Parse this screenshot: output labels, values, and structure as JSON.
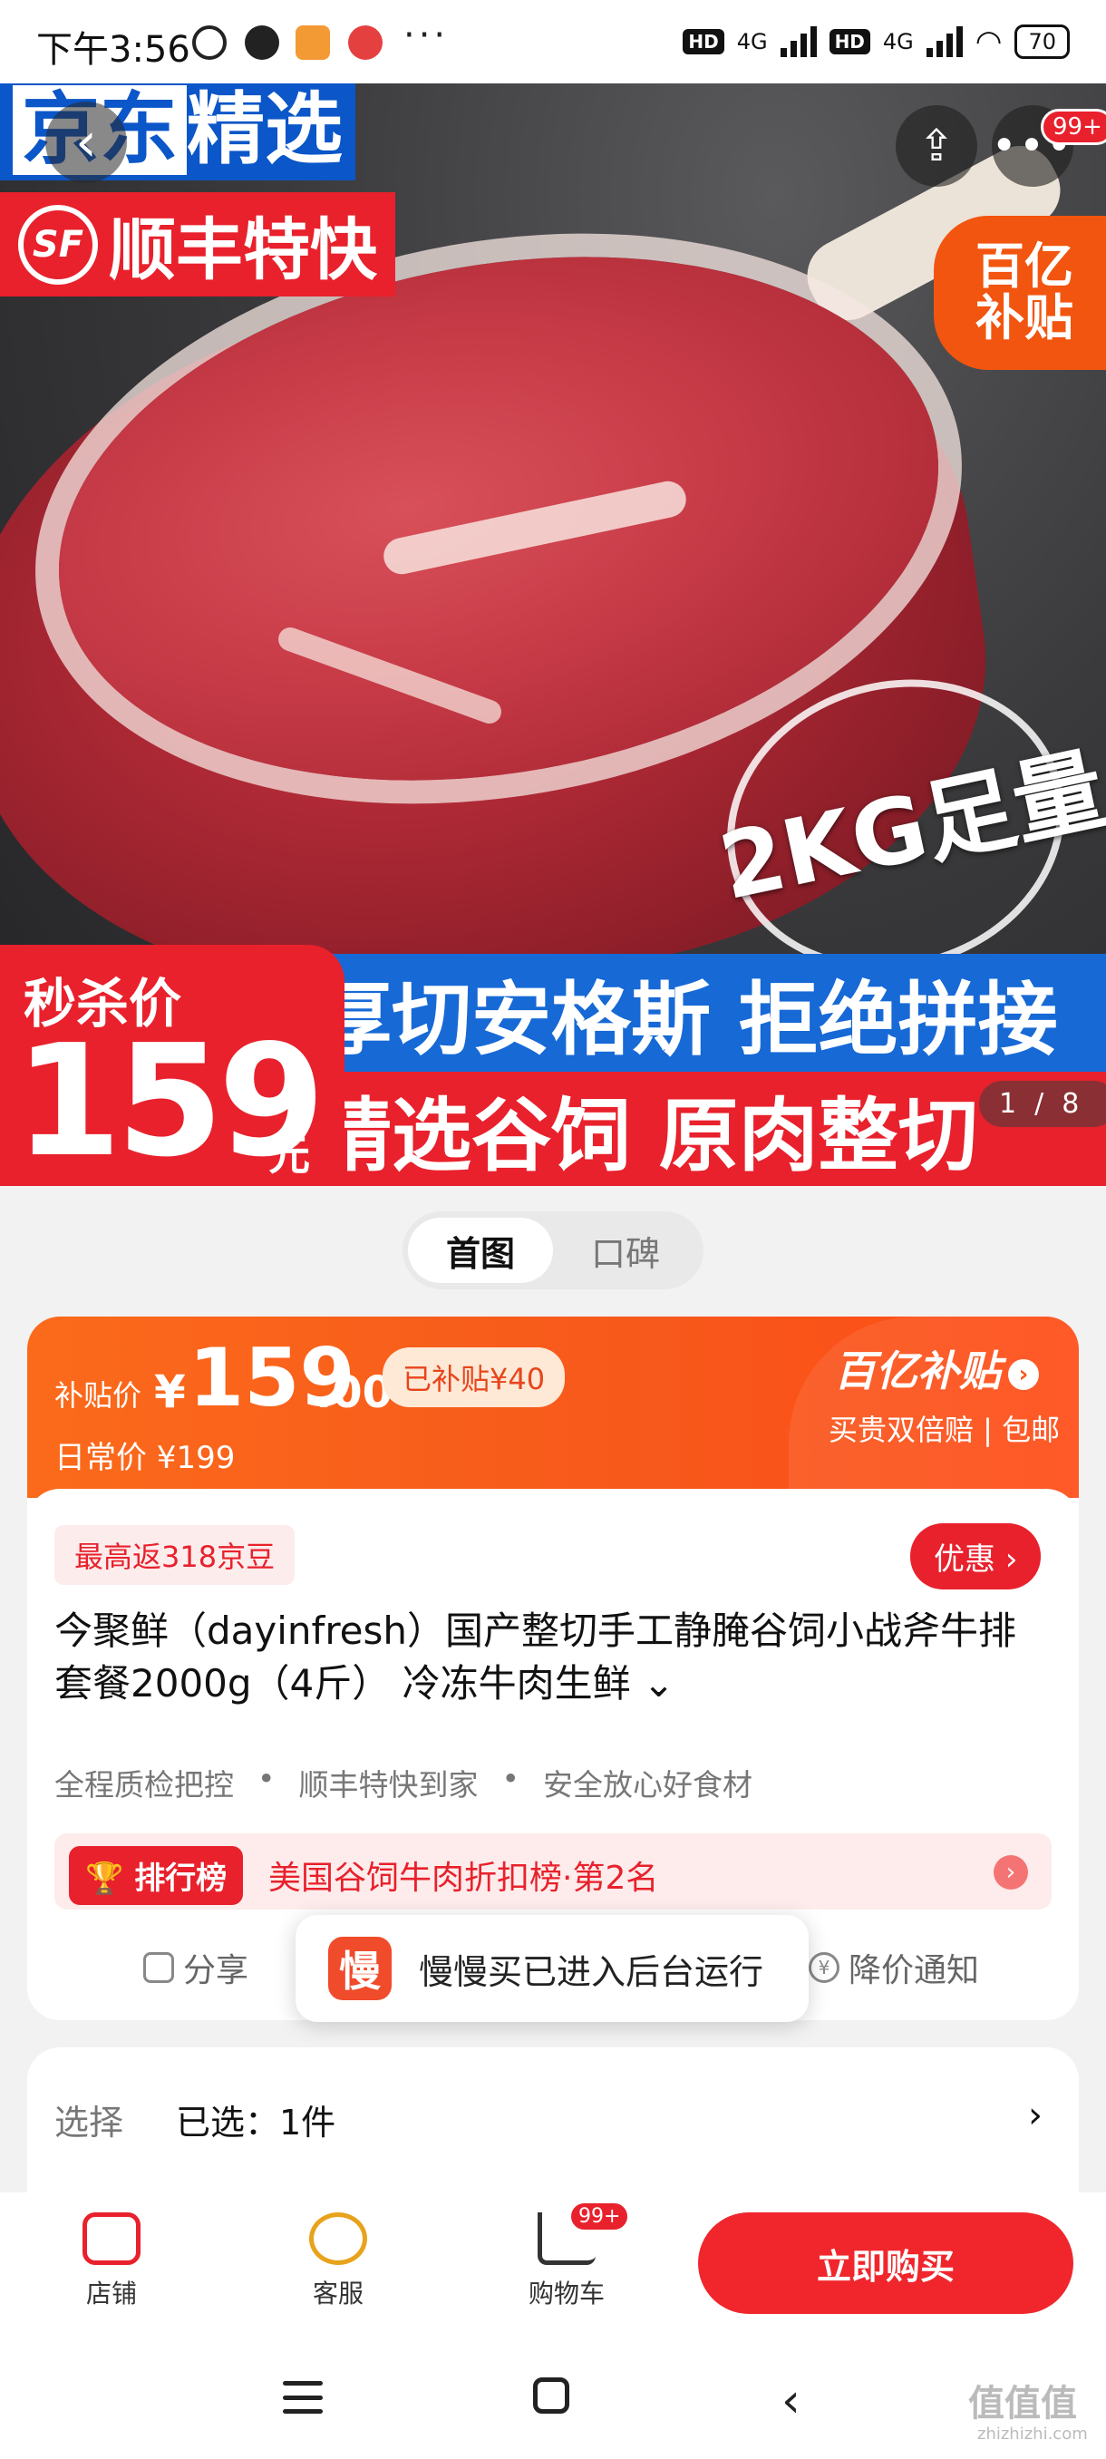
{
  "status_bar": {
    "time": "下午3:56",
    "more": "···",
    "hd1": "HD",
    "net1": "4G",
    "hd2": "HD",
    "net2": "4G",
    "battery": "70"
  },
  "hero": {
    "brand_part1": "京东",
    "brand_part2": "精选",
    "sf_icon": "SF",
    "sf_label": "顺丰特快",
    "subsidy_line1": "百亿",
    "subsidy_line2": "补贴",
    "weight_stamp": "2KG足量",
    "banner_line1": "厚切安格斯 拒绝拼接",
    "banner_line2": "精选谷饲 原肉整切",
    "flash_label": "秒杀价",
    "flash_price": "159",
    "flash_unit": "元",
    "image_counter": "1/8",
    "more_badge": "99+"
  },
  "tabs": [
    {
      "label": "首图",
      "active": true
    },
    {
      "label": "口碑",
      "active": false
    }
  ],
  "price_card": {
    "subsidy_label": "补贴价",
    "currency": "¥",
    "price_int": "159",
    "price_dec": ".00",
    "subsidy_chip": "已补贴¥40",
    "daily_price": "日常价 ¥199",
    "program_name": "百亿补贴",
    "program_sub": "买贵双倍赔 | 包邮"
  },
  "product": {
    "bean_tag": "最高返318京豆",
    "discount_button": "优惠",
    "title": "今聚鲜（dayinfresh）国产整切手工静腌谷饲小战斧牛排套餐2000g（4斤） 冷冻牛肉生鲜",
    "features": [
      "全程质检把控",
      "顺丰特快到家",
      "安全放心好食材"
    ],
    "rank_badge": "排行榜",
    "rank_text": "美国谷饲牛肉折扣榜·第2名",
    "share_label": "分享",
    "price_notice_label": "降价通知"
  },
  "toast": {
    "icon_text": "慢",
    "text": "慢慢买已进入后台运行"
  },
  "select_row": {
    "label": "选择",
    "value": "已选：1件"
  },
  "bottom_bar": {
    "store_label": "店铺",
    "service_label": "客服",
    "cart_label": "购物车",
    "cart_badge": "99+",
    "buy_button": "立即购买"
  },
  "watermark": {
    "text": "值值值",
    "url": "zhizhizhi.com"
  },
  "colors": {
    "jd_red": "#e8212c",
    "subsidy_orange": "#f7581b",
    "jd_blue": "#0b56c8"
  }
}
